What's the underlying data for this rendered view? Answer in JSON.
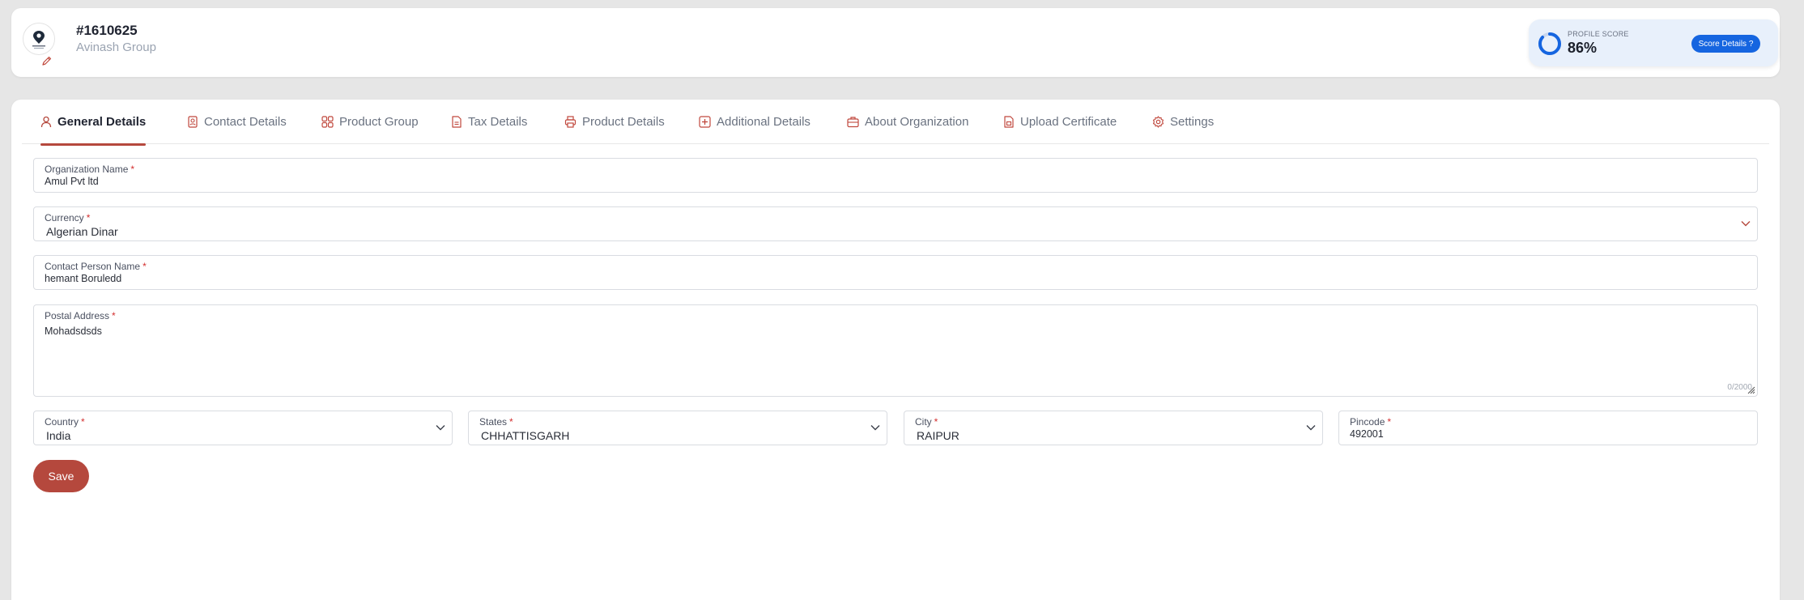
{
  "header": {
    "org_id": "#1610625",
    "org_group": "Avinash Group",
    "profile_score": {
      "label": "PROFILE SCORE",
      "value": "86%",
      "percent": 86,
      "button_label": "Score Details ?"
    }
  },
  "tabs": [
    {
      "label": "General Details",
      "icon": "user-icon",
      "active": true
    },
    {
      "label": "Contact Details",
      "icon": "contact-card-icon",
      "active": false
    },
    {
      "label": "Product Group",
      "icon": "grid-icon",
      "active": false
    },
    {
      "label": "Tax Details",
      "icon": "document-icon",
      "active": false
    },
    {
      "label": "Product Details",
      "icon": "printer-icon",
      "active": false
    },
    {
      "label": "Additional Details",
      "icon": "plus-square-icon",
      "active": false
    },
    {
      "label": "About Organization",
      "icon": "briefcase-icon",
      "active": false
    },
    {
      "label": "Upload Certificate",
      "icon": "file-upload-icon",
      "active": false
    },
    {
      "label": "Settings",
      "icon": "gear-icon",
      "active": false
    }
  ],
  "form": {
    "organization_name": {
      "label": "Organization Name",
      "value": "Amul Pvt ltd"
    },
    "currency": {
      "label": "Currency",
      "value": "Algerian Dinar"
    },
    "contact_person": {
      "label": "Contact Person Name",
      "value": "hemant Boruledd"
    },
    "postal_address": {
      "label": "Postal Address",
      "value": "Mohadsdsds",
      "counter": "0/2000"
    },
    "country": {
      "label": "Country",
      "value": "India"
    },
    "states": {
      "label": "States",
      "value": "CHHATTISGARH"
    },
    "city": {
      "label": "City",
      "value": "RAIPUR"
    },
    "pincode": {
      "label": "Pincode",
      "value": "492001"
    },
    "required_mark": "*",
    "save_label": "Save"
  },
  "colors": {
    "accent": "#b5483d",
    "primary_blue": "#1565e0",
    "required": "#d32f2f"
  }
}
